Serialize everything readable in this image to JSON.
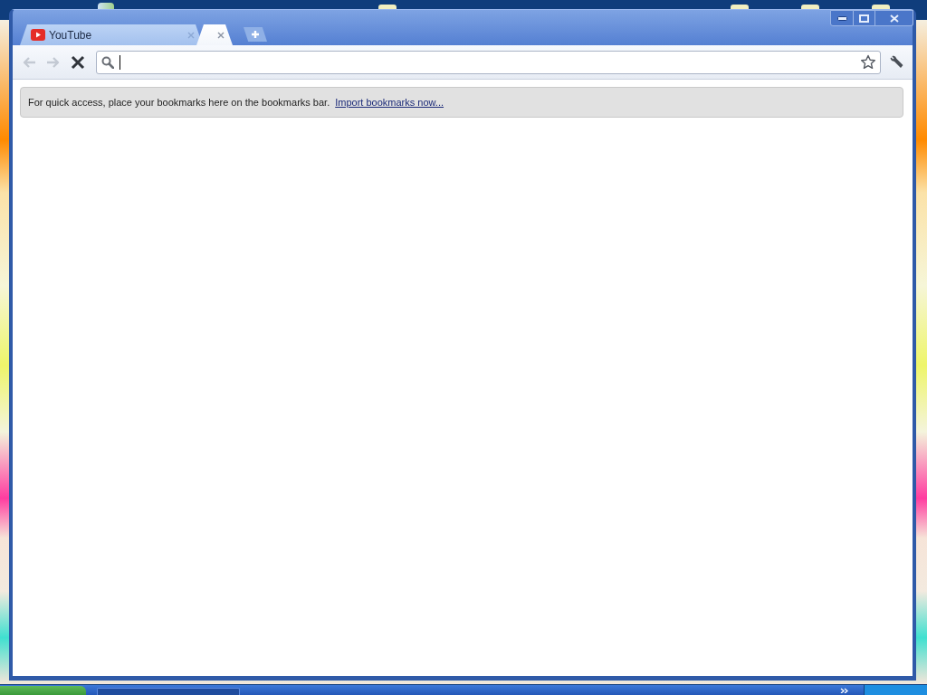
{
  "tabs": [
    {
      "title": "YouTube",
      "selected": false
    },
    {
      "selected": true
    }
  ],
  "navigation": [
    {
      "kind": "back",
      "disabled": true
    },
    {
      "kind": "forward",
      "disabled": true
    },
    {
      "kind": "stop",
      "disabled": false
    }
  ],
  "omnibox": {
    "focused": true,
    "starred": false
  },
  "bookmarks_prompt": {
    "text": "For quick access, place your bookmarks here on the bookmarks bar.",
    "link": "Import bookmarks now..."
  }
}
